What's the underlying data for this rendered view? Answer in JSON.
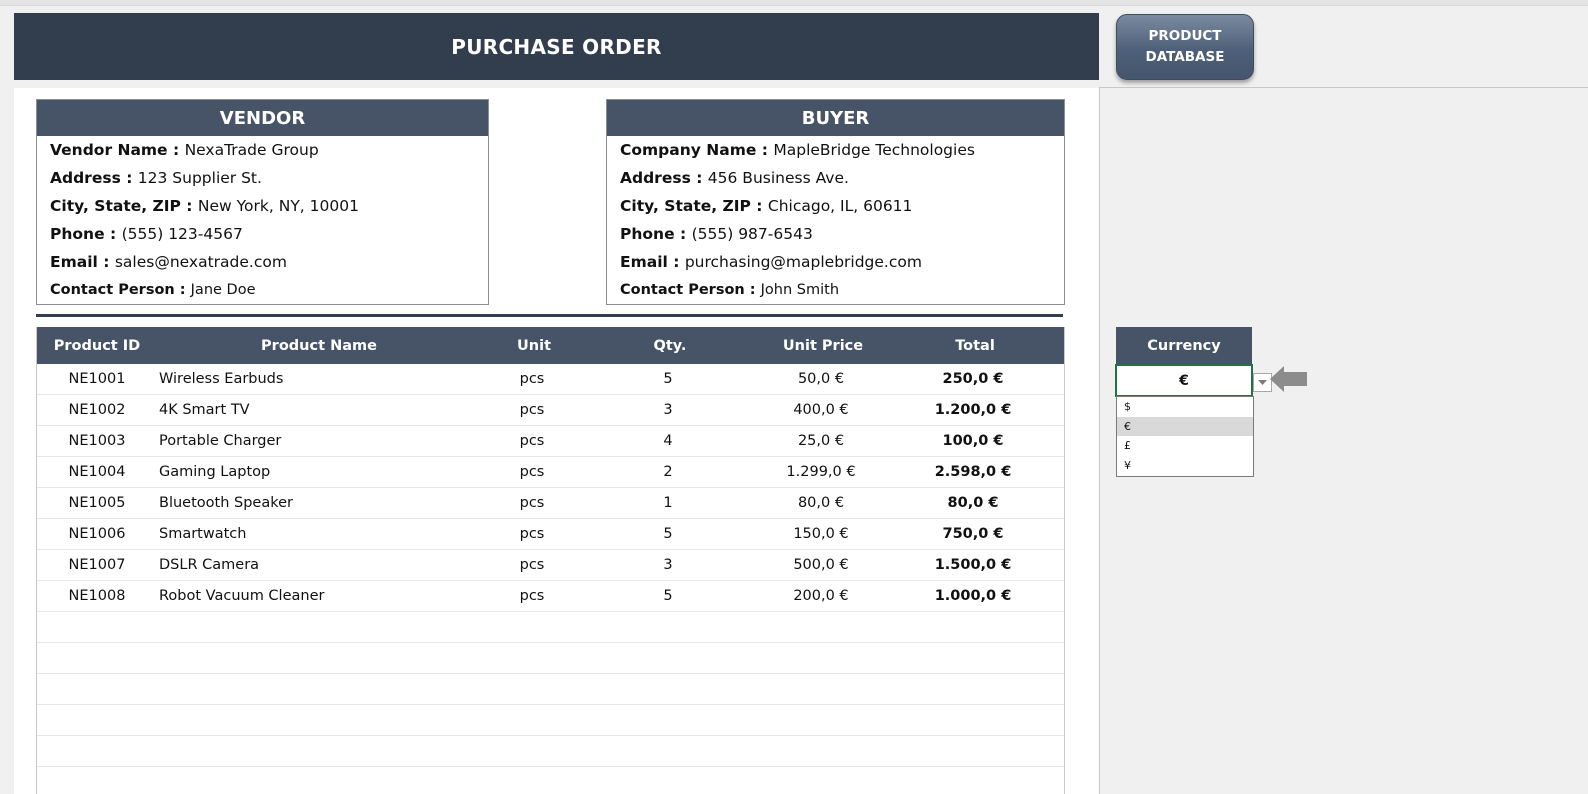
{
  "title": "PURCHASE ORDER",
  "product_db_button": {
    "line1": "PRODUCT",
    "line2": "DATABASE"
  },
  "vendor": {
    "heading": "VENDOR",
    "rows": [
      {
        "label": "Vendor Name",
        "value": "NexaTrade Group"
      },
      {
        "label": "Address",
        "value": "123 Supplier St."
      },
      {
        "label": "City, State, ZIP",
        "value": "New York, NY, 10001"
      },
      {
        "label": "Phone",
        "value": "(555) 123-4567"
      },
      {
        "label": "Email",
        "value": "sales@nexatrade.com"
      },
      {
        "label": "Contact Person",
        "value": "Jane Doe"
      }
    ]
  },
  "buyer": {
    "heading": "BUYER",
    "rows": [
      {
        "label": "Company Name",
        "value": "MapleBridge Technologies"
      },
      {
        "label": "Address",
        "value": "456 Business Ave."
      },
      {
        "label": "City, State, ZIP",
        "value": "Chicago, IL, 60611"
      },
      {
        "label": "Phone",
        "value": "(555) 987-6543"
      },
      {
        "label": "Email",
        "value": "purchasing@maplebridge.com"
      },
      {
        "label": "Contact Person",
        "value": "John Smith"
      }
    ]
  },
  "table": {
    "headers": [
      "Product ID",
      "Product Name",
      "Unit",
      "Qty.",
      "Unit Price",
      "Total"
    ],
    "rows": [
      {
        "id": "NE1001",
        "name": "Wireless Earbuds",
        "unit": "pcs",
        "qty": "5",
        "price": "50,0 €",
        "total": "250,0 €"
      },
      {
        "id": "NE1002",
        "name": "4K Smart TV",
        "unit": "pcs",
        "qty": "3",
        "price": "400,0 €",
        "total": "1.200,0 €"
      },
      {
        "id": "NE1003",
        "name": "Portable Charger",
        "unit": "pcs",
        "qty": "4",
        "price": "25,0 €",
        "total": "100,0 €"
      },
      {
        "id": "NE1004",
        "name": "Gaming Laptop",
        "unit": "pcs",
        "qty": "2",
        "price": "1.299,0 €",
        "total": "2.598,0 €"
      },
      {
        "id": "NE1005",
        "name": "Bluetooth Speaker",
        "unit": "pcs",
        "qty": "1",
        "price": "80,0 €",
        "total": "80,0 €"
      },
      {
        "id": "NE1006",
        "name": "Smartwatch",
        "unit": "pcs",
        "qty": "5",
        "price": "150,0 €",
        "total": "750,0 €"
      },
      {
        "id": "NE1007",
        "name": "DSLR Camera",
        "unit": "pcs",
        "qty": "3",
        "price": "500,0 €",
        "total": "1.500,0 €"
      },
      {
        "id": "NE1008",
        "name": "Robot Vacuum Cleaner",
        "unit": "pcs",
        "qty": "5",
        "price": "200,0 €",
        "total": "1.000,0 €"
      }
    ],
    "empty_rows": 6
  },
  "currency": {
    "heading": "Currency",
    "selected": "€",
    "options": [
      "$",
      "€",
      "£",
      "¥"
    ],
    "selected_index": 1
  },
  "colors": {
    "title_bg": "#323d4e",
    "header_bg": "#475467",
    "active_cell_border": "#217346"
  },
  "icons": {
    "dropdown": "dropdown-arrow-icon",
    "pointer": "left-arrow-icon"
  }
}
